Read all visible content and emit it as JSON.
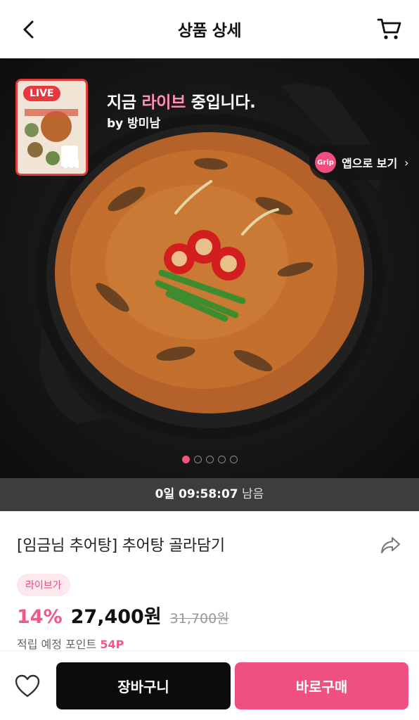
{
  "header": {
    "title": "상품 상세",
    "back_icon": "chevron-left-icon",
    "cart_icon": "cart-icon"
  },
  "hero": {
    "live_badge": "LIVE",
    "live_prefix": "지금 ",
    "live_highlight": "라이브",
    "live_suffix": " 중입니다.",
    "by_line": "by 방미남",
    "grip_logo": "Grip",
    "app_button": "앱으로 보기",
    "carousel": {
      "total": 5,
      "active": 1
    }
  },
  "countdown": {
    "time": "0일 09:58:07",
    "suffix": " 남음"
  },
  "product": {
    "title": "[임금님 추어탕] 추어탕 골라담기",
    "tag": "라이브가",
    "discount": "14%",
    "price": "27,400원",
    "original_price": "31,700원",
    "points_label": "적립 예정 포인트 ",
    "points_value": "54P"
  },
  "bottom_bar": {
    "cart_button": "장바구니",
    "buy_button": "바로구매"
  },
  "colors": {
    "accent_pink": "#f0507f",
    "live_red": "#e8383d",
    "countdown_bg": "#3d3d3d"
  }
}
